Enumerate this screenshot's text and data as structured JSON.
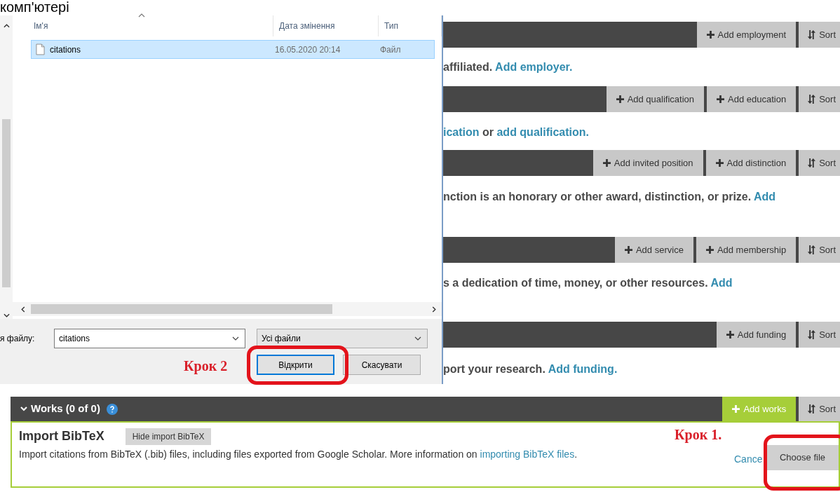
{
  "page_heading": "комп'ютері",
  "sections": [
    {
      "buttons": [
        {
          "label": "Add employment",
          "kind": "add"
        },
        {
          "label": "Sort",
          "kind": "sort"
        }
      ],
      "description": [
        {
          "text": "affiliated. ",
          "link": false
        },
        {
          "text": "Add employer.",
          "link": true
        }
      ]
    },
    {
      "buttons": [
        {
          "label": "Add qualification",
          "kind": "add"
        },
        {
          "label": "Add education",
          "kind": "add"
        },
        {
          "label": "Sort",
          "kind": "sort"
        }
      ],
      "description": [
        {
          "text": "ication",
          "link": true
        },
        {
          "text": " or ",
          "link": false
        },
        {
          "text": "add qualification.",
          "link": true
        }
      ]
    },
    {
      "buttons": [
        {
          "label": "Add invited position",
          "kind": "add"
        },
        {
          "label": "Add distinction",
          "kind": "add"
        },
        {
          "label": "Sort",
          "kind": "sort"
        }
      ],
      "description": [
        {
          "text": "nction is an honorary or other award, distinction, or prize. ",
          "link": false
        },
        {
          "text": "Add",
          "link": true
        }
      ]
    },
    {
      "buttons": [
        {
          "label": "Add service",
          "kind": "add"
        },
        {
          "label": "Add membership",
          "kind": "add"
        },
        {
          "label": "Sort",
          "kind": "sort"
        }
      ],
      "description": [
        {
          "text": "s a dedication of time, money, or other resources. ",
          "link": false
        },
        {
          "text": "Add",
          "link": true
        }
      ]
    },
    {
      "buttons": [
        {
          "label": "Add funding",
          "kind": "add"
        },
        {
          "label": "Sort",
          "kind": "sort"
        }
      ],
      "description": [
        {
          "text": "port your research. ",
          "link": false
        },
        {
          "text": "Add funding.",
          "link": true
        }
      ]
    }
  ],
  "works": {
    "title": "Works (0 of 0)",
    "buttons": [
      {
        "label": "Add works",
        "kind": "add",
        "highlighted": true
      },
      {
        "label": "Sort",
        "kind": "sort",
        "highlighted": false
      }
    ],
    "import": {
      "title": "Import BibTeX",
      "hide_button": "Hide import BibTeX",
      "text": "Import citations from BibTeX (.bib) files, including files exported from Google Scholar. More information on ",
      "link": "importing BibTeX files",
      "after_link": ".",
      "cancel": "Cance",
      "choose_button": "Choose file",
      "step_label": "Крок 1."
    }
  },
  "dialog": {
    "columns": [
      {
        "label": "Ім'я",
        "sorted": true
      },
      {
        "label": "Дата змінення",
        "sorted": false
      },
      {
        "label": "Тип",
        "sorted": false
      }
    ],
    "rows": [
      {
        "name": "citations",
        "date": "16.05.2020 20:14",
        "type": "Файл",
        "selected": true
      }
    ],
    "filename_label": "я файлу:",
    "filename": "citations",
    "filter": "Усі файли",
    "buttons": [
      {
        "label": "Відкрити",
        "default": true
      },
      {
        "label": "Скасувати",
        "default": false
      }
    ],
    "step_label": "Крок 2"
  }
}
